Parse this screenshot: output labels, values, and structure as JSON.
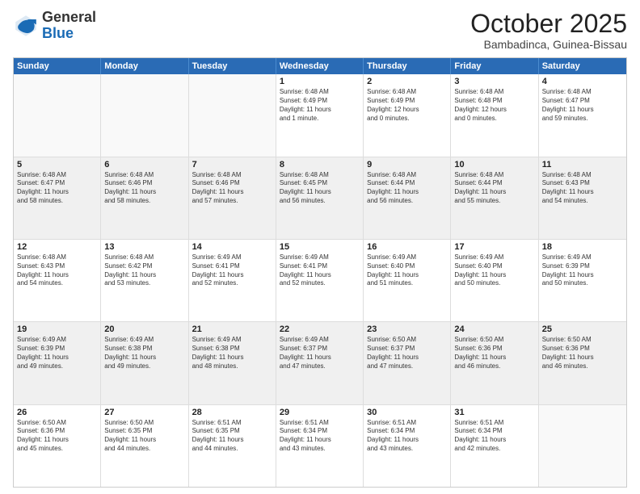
{
  "header": {
    "logo": {
      "general": "General",
      "blue": "Blue"
    },
    "month": "October 2025",
    "location": "Bambadinca, Guinea-Bissau"
  },
  "weekdays": [
    "Sunday",
    "Monday",
    "Tuesday",
    "Wednesday",
    "Thursday",
    "Friday",
    "Saturday"
  ],
  "rows": [
    [
      {
        "day": "",
        "lines": [],
        "empty": true
      },
      {
        "day": "",
        "lines": [],
        "empty": true
      },
      {
        "day": "",
        "lines": [],
        "empty": true
      },
      {
        "day": "1",
        "lines": [
          "Sunrise: 6:48 AM",
          "Sunset: 6:49 PM",
          "Daylight: 11 hours",
          "and 1 minute."
        ]
      },
      {
        "day": "2",
        "lines": [
          "Sunrise: 6:48 AM",
          "Sunset: 6:49 PM",
          "Daylight: 12 hours",
          "and 0 minutes."
        ]
      },
      {
        "day": "3",
        "lines": [
          "Sunrise: 6:48 AM",
          "Sunset: 6:48 PM",
          "Daylight: 12 hours",
          "and 0 minutes."
        ]
      },
      {
        "day": "4",
        "lines": [
          "Sunrise: 6:48 AM",
          "Sunset: 6:47 PM",
          "Daylight: 11 hours",
          "and 59 minutes."
        ]
      }
    ],
    [
      {
        "day": "5",
        "lines": [
          "Sunrise: 6:48 AM",
          "Sunset: 6:47 PM",
          "Daylight: 11 hours",
          "and 58 minutes."
        ],
        "shaded": true
      },
      {
        "day": "6",
        "lines": [
          "Sunrise: 6:48 AM",
          "Sunset: 6:46 PM",
          "Daylight: 11 hours",
          "and 58 minutes."
        ],
        "shaded": true
      },
      {
        "day": "7",
        "lines": [
          "Sunrise: 6:48 AM",
          "Sunset: 6:46 PM",
          "Daylight: 11 hours",
          "and 57 minutes."
        ],
        "shaded": true
      },
      {
        "day": "8",
        "lines": [
          "Sunrise: 6:48 AM",
          "Sunset: 6:45 PM",
          "Daylight: 11 hours",
          "and 56 minutes."
        ],
        "shaded": true
      },
      {
        "day": "9",
        "lines": [
          "Sunrise: 6:48 AM",
          "Sunset: 6:44 PM",
          "Daylight: 11 hours",
          "and 56 minutes."
        ],
        "shaded": true
      },
      {
        "day": "10",
        "lines": [
          "Sunrise: 6:48 AM",
          "Sunset: 6:44 PM",
          "Daylight: 11 hours",
          "and 55 minutes."
        ],
        "shaded": true
      },
      {
        "day": "11",
        "lines": [
          "Sunrise: 6:48 AM",
          "Sunset: 6:43 PM",
          "Daylight: 11 hours",
          "and 54 minutes."
        ],
        "shaded": true
      }
    ],
    [
      {
        "day": "12",
        "lines": [
          "Sunrise: 6:48 AM",
          "Sunset: 6:43 PM",
          "Daylight: 11 hours",
          "and 54 minutes."
        ]
      },
      {
        "day": "13",
        "lines": [
          "Sunrise: 6:48 AM",
          "Sunset: 6:42 PM",
          "Daylight: 11 hours",
          "and 53 minutes."
        ]
      },
      {
        "day": "14",
        "lines": [
          "Sunrise: 6:49 AM",
          "Sunset: 6:41 PM",
          "Daylight: 11 hours",
          "and 52 minutes."
        ]
      },
      {
        "day": "15",
        "lines": [
          "Sunrise: 6:49 AM",
          "Sunset: 6:41 PM",
          "Daylight: 11 hours",
          "and 52 minutes."
        ]
      },
      {
        "day": "16",
        "lines": [
          "Sunrise: 6:49 AM",
          "Sunset: 6:40 PM",
          "Daylight: 11 hours",
          "and 51 minutes."
        ]
      },
      {
        "day": "17",
        "lines": [
          "Sunrise: 6:49 AM",
          "Sunset: 6:40 PM",
          "Daylight: 11 hours",
          "and 50 minutes."
        ]
      },
      {
        "day": "18",
        "lines": [
          "Sunrise: 6:49 AM",
          "Sunset: 6:39 PM",
          "Daylight: 11 hours",
          "and 50 minutes."
        ]
      }
    ],
    [
      {
        "day": "19",
        "lines": [
          "Sunrise: 6:49 AM",
          "Sunset: 6:39 PM",
          "Daylight: 11 hours",
          "and 49 minutes."
        ],
        "shaded": true
      },
      {
        "day": "20",
        "lines": [
          "Sunrise: 6:49 AM",
          "Sunset: 6:38 PM",
          "Daylight: 11 hours",
          "and 49 minutes."
        ],
        "shaded": true
      },
      {
        "day": "21",
        "lines": [
          "Sunrise: 6:49 AM",
          "Sunset: 6:38 PM",
          "Daylight: 11 hours",
          "and 48 minutes."
        ],
        "shaded": true
      },
      {
        "day": "22",
        "lines": [
          "Sunrise: 6:49 AM",
          "Sunset: 6:37 PM",
          "Daylight: 11 hours",
          "and 47 minutes."
        ],
        "shaded": true
      },
      {
        "day": "23",
        "lines": [
          "Sunrise: 6:50 AM",
          "Sunset: 6:37 PM",
          "Daylight: 11 hours",
          "and 47 minutes."
        ],
        "shaded": true
      },
      {
        "day": "24",
        "lines": [
          "Sunrise: 6:50 AM",
          "Sunset: 6:36 PM",
          "Daylight: 11 hours",
          "and 46 minutes."
        ],
        "shaded": true
      },
      {
        "day": "25",
        "lines": [
          "Sunrise: 6:50 AM",
          "Sunset: 6:36 PM",
          "Daylight: 11 hours",
          "and 46 minutes."
        ],
        "shaded": true
      }
    ],
    [
      {
        "day": "26",
        "lines": [
          "Sunrise: 6:50 AM",
          "Sunset: 6:36 PM",
          "Daylight: 11 hours",
          "and 45 minutes."
        ]
      },
      {
        "day": "27",
        "lines": [
          "Sunrise: 6:50 AM",
          "Sunset: 6:35 PM",
          "Daylight: 11 hours",
          "and 44 minutes."
        ]
      },
      {
        "day": "28",
        "lines": [
          "Sunrise: 6:51 AM",
          "Sunset: 6:35 PM",
          "Daylight: 11 hours",
          "and 44 minutes."
        ]
      },
      {
        "day": "29",
        "lines": [
          "Sunrise: 6:51 AM",
          "Sunset: 6:34 PM",
          "Daylight: 11 hours",
          "and 43 minutes."
        ]
      },
      {
        "day": "30",
        "lines": [
          "Sunrise: 6:51 AM",
          "Sunset: 6:34 PM",
          "Daylight: 11 hours",
          "and 43 minutes."
        ]
      },
      {
        "day": "31",
        "lines": [
          "Sunrise: 6:51 AM",
          "Sunset: 6:34 PM",
          "Daylight: 11 hours",
          "and 42 minutes."
        ]
      },
      {
        "day": "",
        "lines": [],
        "empty": true
      }
    ]
  ]
}
